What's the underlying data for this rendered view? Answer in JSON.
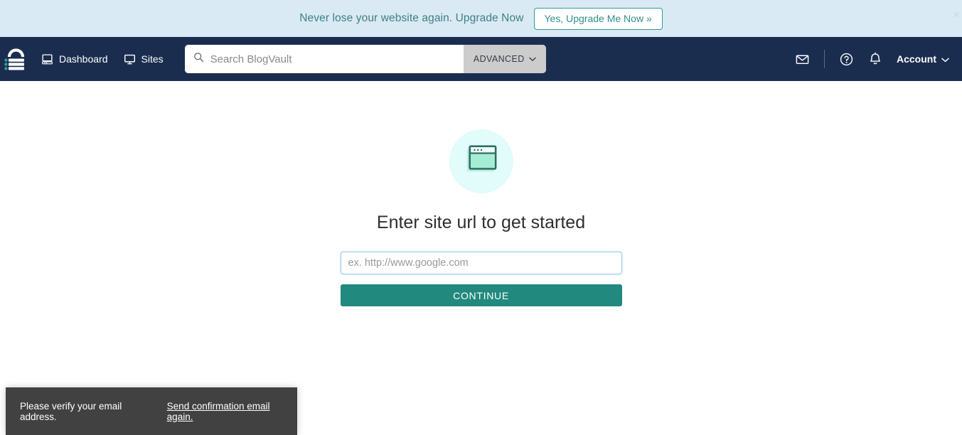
{
  "promo": {
    "text": "Never lose your website again. Upgrade Now",
    "button_label": "Yes, Upgrade Me Now »",
    "close_label": "×",
    "bg_color": "#d9eaf4",
    "accent_color": "#2f8f86"
  },
  "navbar": {
    "bg_color": "#1b2d4f",
    "brand_name": "blogvault-logo",
    "links": [
      {
        "label": "Dashboard",
        "icon": "desktop-computer-icon"
      },
      {
        "label": "Sites",
        "icon": "monitor-icon"
      }
    ],
    "search": {
      "placeholder": "Search BlogVault",
      "value": "",
      "icon": "search-icon",
      "advanced_label": "ADVANCED",
      "advanced_caret": "chevron-down-icon"
    },
    "right": {
      "mail_icon": "envelope-icon",
      "help_icon": "question-circle-icon",
      "bell_icon": "bell-icon",
      "account_label": "Account",
      "account_caret": "chevron-down-icon"
    }
  },
  "main": {
    "hero_icon": "browser-window-icon",
    "hero_circle_color": "#e2fbfb",
    "title": "Enter site url to get started",
    "url_input": {
      "placeholder": "ex. http://www.google.com",
      "value": ""
    },
    "continue_label": "CONTINUE",
    "continue_color": "#21897e"
  },
  "toast": {
    "message": "Please verify your email address.",
    "link_label": "Send confirmation email again.",
    "bg_color": "#414141"
  }
}
